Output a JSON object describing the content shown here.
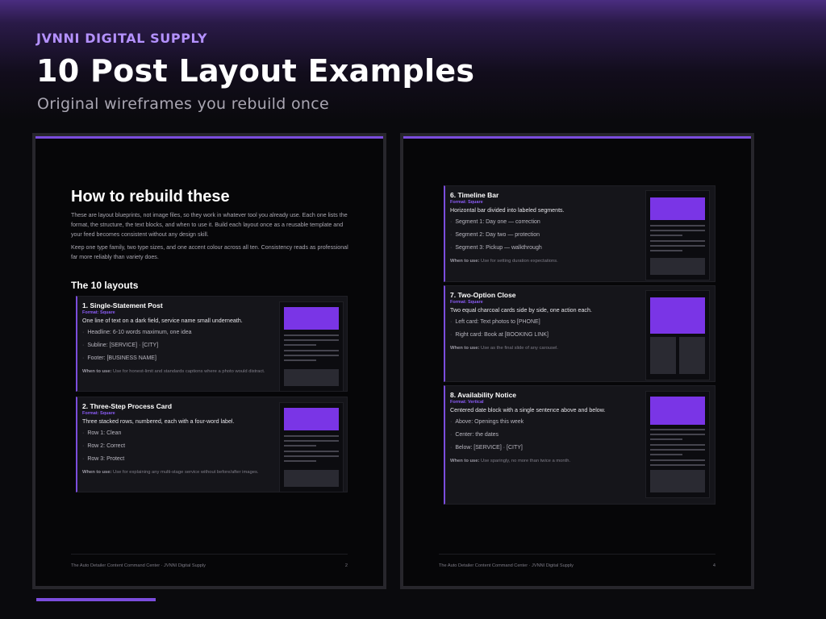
{
  "header": {
    "brand": "JVNNI DIGITAL SUPPLY",
    "title": "10 Post Layout Examples",
    "subtitle": "Original wireframes you rebuild once"
  },
  "left_page": {
    "intro_title": "How to rebuild these",
    "intro_p1": "These are layout blueprints, not image files, so they work in whatever tool you already use. Each one lists the format, the structure, the text blocks, and when to use it. Build each layout once as a reusable template and your feed becomes consistent without any design skill.",
    "intro_p2": "Keep one type family, two type sizes, and one accent colour across all ten. Consistency reads as professional far more reliably than variety does.",
    "layouts_heading": "The 10 layouts",
    "cards": [
      {
        "title": "1. Single-Statement Post",
        "format": "Format: Square",
        "desc": "One line of text on a dark field, service name small underneath.",
        "items": [
          "Headline: 6-10 words maximum, one idea",
          "Subline: [SERVICE] · [CITY]",
          "Footer: [BUSINESS NAME]"
        ],
        "when_label": "When to use:",
        "when_text": "Use for honest-limit and standards captions where a photo would distract."
      },
      {
        "title": "2. Three-Step Process Card",
        "format": "Format: Square",
        "desc": "Three stacked rows, numbered, each with a four-word label.",
        "items": [
          "Row 1: Clean",
          "Row 2: Correct",
          "Row 3: Protect"
        ],
        "when_label": "When to use:",
        "when_text": "Use for explaining any multi-stage service without before/after images."
      }
    ],
    "footer_text": "The Auto Detailer Content Command Center  ·  JVNNI Digital Supply",
    "page_number": "2"
  },
  "right_page": {
    "cards": [
      {
        "title": "6. Timeline Bar",
        "format": "Format: Square",
        "desc": "Horizontal bar divided into labeled segments.",
        "items": [
          "Segment 1: Day one — correction",
          "Segment 2: Day two — protection",
          "Segment 3: Pickup — walkthrough"
        ],
        "when_label": "When to use:",
        "when_text": "Use for setting duration expectations."
      },
      {
        "title": "7. Two-Option Close",
        "format": "Format: Square",
        "desc": "Two equal charcoal cards side by side, one action each.",
        "items": [
          "Left card: Text photos to [PHONE]",
          "Right card: Book at [BOOKING LINK]"
        ],
        "when_label": "When to use:",
        "when_text": "Use as the final slide of any carousel."
      },
      {
        "title": "8. Availability Notice",
        "format": "Format: Vertical",
        "desc": "Centered date block with a single sentence above and below.",
        "items": [
          "Above: Openings this week",
          "Center: the dates",
          "Below: [SERVICE] · [CITY]"
        ],
        "when_label": "When to use:",
        "when_text": "Use sparingly, no more than twice a month."
      }
    ],
    "footer_text": "The Auto Detailer Content Command Center  ·  JVNNI Digital Supply",
    "page_number": "4"
  },
  "colors": {
    "accent": "#7b4ddd",
    "brand": "#b491ff",
    "thumb_block": "#7a35e6",
    "card_bg": "#15151a",
    "page_bg": "#060608"
  }
}
